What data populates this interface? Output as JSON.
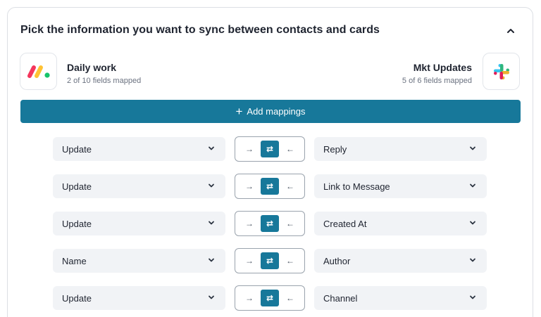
{
  "header": {
    "title": "Pick the information you want to sync between contacts and cards"
  },
  "left_app": {
    "name": "Daily work",
    "subtitle": "2 of 10 fields mapped",
    "icon": "monday-logo-icon"
  },
  "right_app": {
    "name": "Mkt Updates",
    "subtitle": "5 of 6 fields mapped",
    "icon": "slack-logo-icon"
  },
  "add_button": {
    "label": "Add mappings"
  },
  "direction_glyphs": {
    "left_to_right": "→",
    "both": "⇄",
    "right_to_left": "←"
  },
  "mappings": [
    {
      "left": "Update",
      "right": "Reply",
      "direction": "both"
    },
    {
      "left": "Update",
      "right": "Link to Message",
      "direction": "both"
    },
    {
      "left": "Update",
      "right": "Created At",
      "direction": "both"
    },
    {
      "left": "Name",
      "right": "Author",
      "direction": "both"
    },
    {
      "left": "Update",
      "right": "Channel",
      "direction": "both"
    }
  ],
  "colors": {
    "accent": "#17789a",
    "select_bg": "#f1f3f6",
    "border": "#dcdfe4"
  }
}
